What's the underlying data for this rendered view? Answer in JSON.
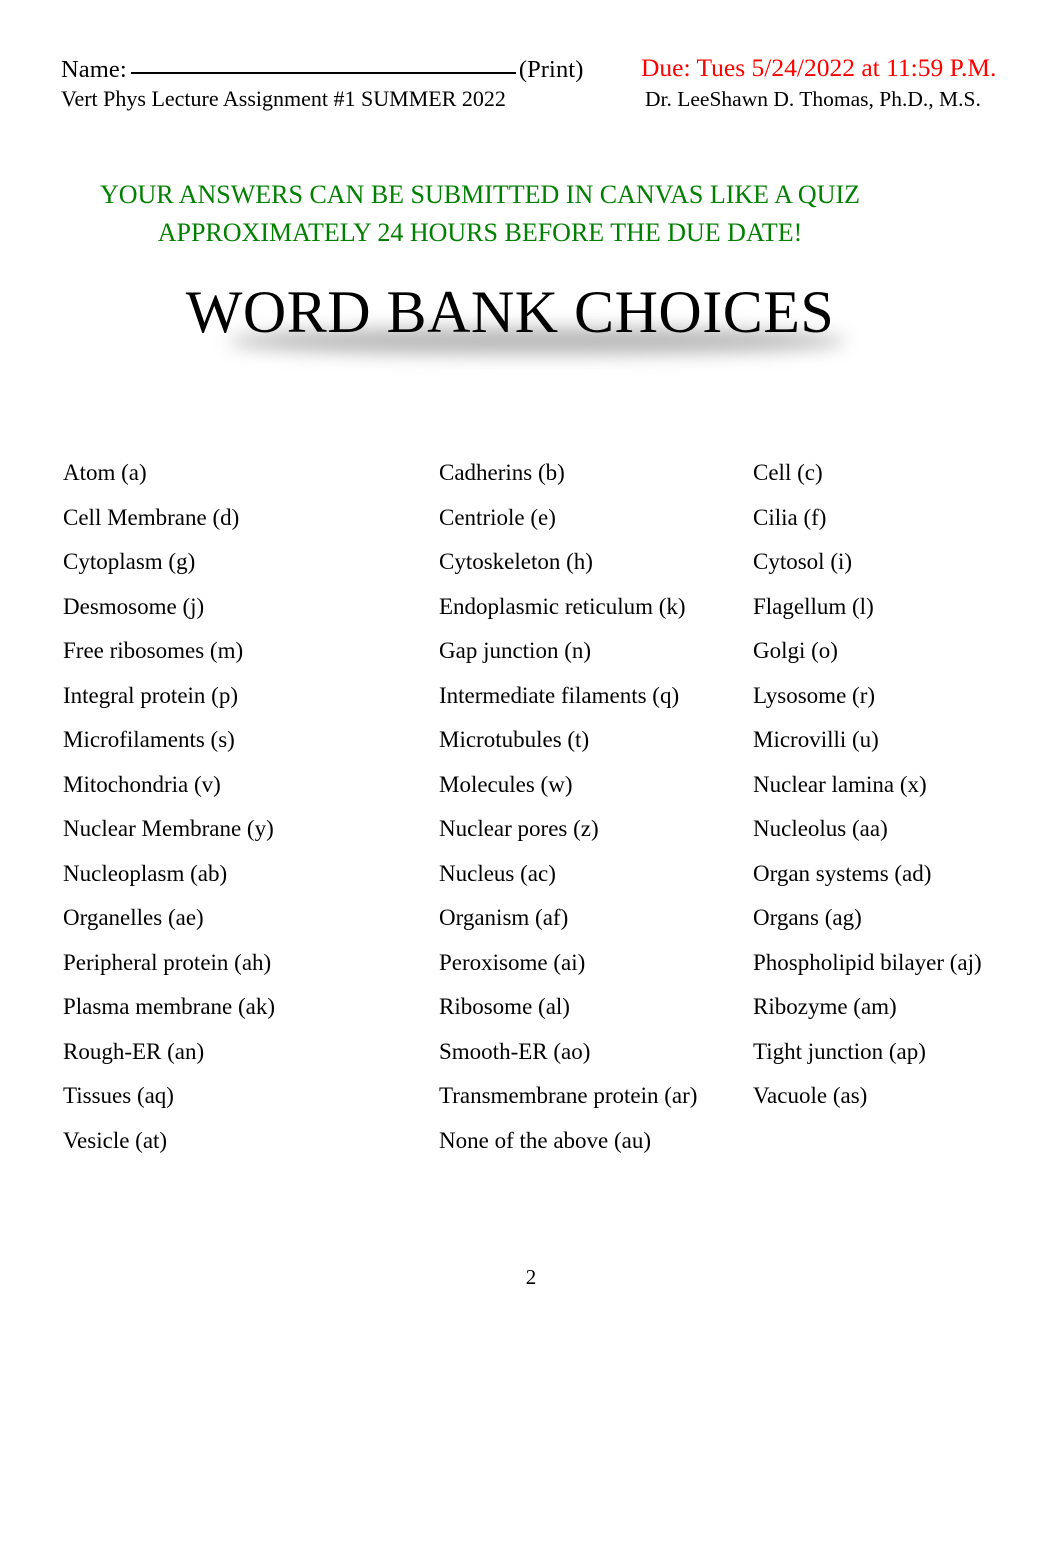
{
  "header": {
    "name_label": "Name:",
    "print_label": "(Print)",
    "course_line": "Vert Phys Lecture Assignment #1 SUMMER 2022",
    "due_text": "Due: Tues 5/24/2022 at 11:59 P.M.",
    "instructor": "Dr. LeeShawn D. Thomas, Ph.D., M.S.",
    "notice_line_1": "YOUR ANSWERS CAN BE SUBMITTED IN CANVAS LIKE A QUIZ",
    "notice_line_2": "APPROXIMATELY 24 HOURS BEFORE THE DUE DATE!",
    "due_color": "#ff0000",
    "notice_color": "#008000"
  },
  "title": {
    "text": "WORD BANK CHOICES"
  },
  "word_bank": {
    "rows": [
      {
        "c1": "Atom (a)",
        "c2": "Cadherins (b)",
        "c3": "Cell (c)"
      },
      {
        "c1": "Cell Membrane (d)",
        "c2": "Centriole (e)",
        "c3": "Cilia (f)"
      },
      {
        "c1": "Cytoplasm (g)",
        "c2": "Cytoskeleton (h)",
        "c3": "Cytosol (i)"
      },
      {
        "c1": "Desmosome (j)",
        "c2": "Endoplasmic reticulum (k)",
        "c3": "Flagellum (l)"
      },
      {
        "c1": "Free ribosomes (m)",
        "c2": "Gap junction (n)",
        "c3": "Golgi (o)"
      },
      {
        "c1": "Integral protein (p)",
        "c2": "Intermediate filaments (q)",
        "c3": "Lysosome (r)"
      },
      {
        "c1": "Microfilaments (s)",
        "c2": "Microtubules (t)",
        "c3": "Microvilli (u)"
      },
      {
        "c1": "Mitochondria (v)",
        "c2": "Molecules (w)",
        "c3": "Nuclear lamina (x)"
      },
      {
        "c1": "Nuclear Membrane (y)",
        "c2": "Nuclear pores (z)",
        "c3": "Nucleolus (aa)"
      },
      {
        "c1": "Nucleoplasm (ab)",
        "c2": "Nucleus (ac)",
        "c3": "Organ systems (ad)"
      },
      {
        "c1": "Organelles (ae)",
        "c2": "Organism (af)",
        "c3": "Organs (ag)"
      },
      {
        "c1": "Peripheral protein (ah)",
        "c2": "Peroxisome (ai)",
        "c3": "Phospholipid bilayer (aj)"
      },
      {
        "c1": "Plasma membrane (ak)",
        "c2": "Ribosome (al)",
        "c3": "Ribozyme (am)"
      },
      {
        "c1": "Rough-ER (an)",
        "c2": "Smooth-ER (ao)",
        "c3": "Tight junction (ap)"
      },
      {
        "c1": "Tissues (aq)",
        "c2": "Transmembrane protein (ar)",
        "c3": "Vacuole (as)"
      },
      {
        "c1": "Vesicle (at)",
        "c2": "None of the above (au)",
        "c3": ""
      }
    ]
  },
  "footer": {
    "page_number": "2"
  }
}
